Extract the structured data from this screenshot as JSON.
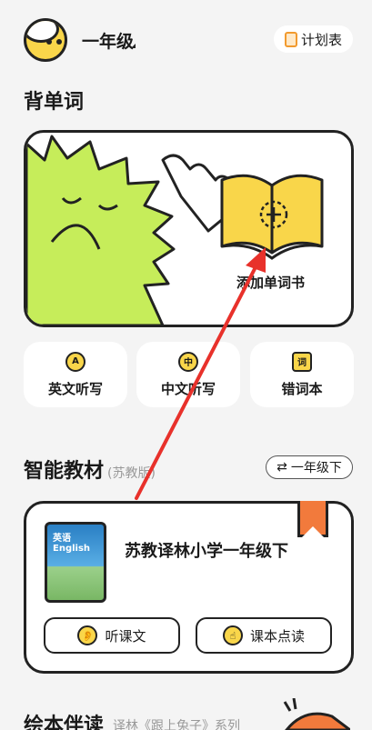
{
  "header": {
    "grade": "一年级",
    "plan_label": "计划表"
  },
  "vocab": {
    "title": "背单词",
    "add_book_label": "添加单词书",
    "actions": [
      {
        "label": "英文听写",
        "icon": "english-dictation-icon",
        "glyph": "A"
      },
      {
        "label": "中文听写",
        "icon": "chinese-dictation-icon",
        "glyph": "中"
      },
      {
        "label": "错词本",
        "icon": "wrong-words-icon",
        "glyph": "词"
      }
    ]
  },
  "textbook": {
    "title": "智能教材",
    "edition": "(苏教版)",
    "switch_label": "一年级下",
    "book_name": "苏教译林小学一年级下",
    "cover_text": "英语\nEnglish",
    "buttons": [
      {
        "label": "听课文",
        "icon": "ear-icon"
      },
      {
        "label": "课本点读",
        "icon": "finger-tap-icon"
      }
    ]
  },
  "picture_books": {
    "title": "绘本伴读",
    "subtitle": "译林《跟上兔子》系列"
  },
  "colors": {
    "yellow": "#f9d64a",
    "green": "#c6ed5a",
    "orange": "#f27a3c",
    "arrow": "#e8312b"
  }
}
